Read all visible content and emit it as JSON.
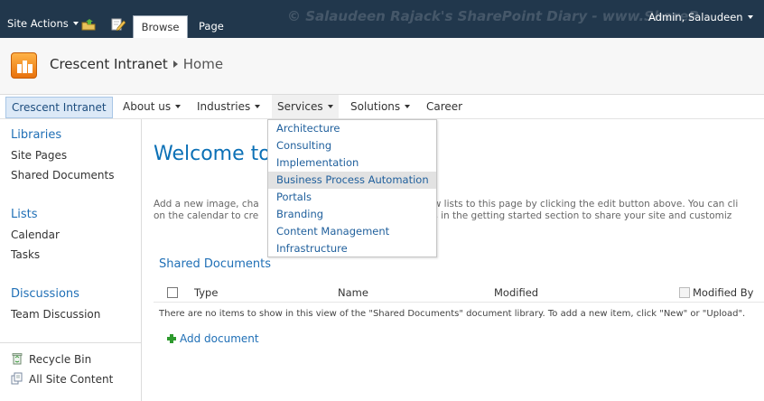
{
  "ribbon": {
    "site_actions_label": "Site Actions",
    "tabs": [
      {
        "label": "Browse",
        "selected": true
      },
      {
        "label": "Page",
        "selected": false
      }
    ],
    "watermark": "© Salaudeen Rajack's SharePoint Diary - www.ShareP",
    "user_name": "Admin, Salaudeen"
  },
  "site": {
    "title": "Crescent Intranet",
    "current_page": "Home"
  },
  "topnav": {
    "items": [
      {
        "label": "Crescent Intranet",
        "selected": true,
        "has_menu": false
      },
      {
        "label": "About us",
        "has_menu": true
      },
      {
        "label": "Industries",
        "has_menu": true
      },
      {
        "label": "Services",
        "has_menu": true,
        "open": true
      },
      {
        "label": "Solutions",
        "has_menu": true
      },
      {
        "label": "Career",
        "has_menu": false
      }
    ]
  },
  "dropdown": {
    "items": [
      {
        "label": "Architecture"
      },
      {
        "label": "Consulting"
      },
      {
        "label": "Implementation"
      },
      {
        "label": "Business Process Automation",
        "hover": true
      },
      {
        "label": "Portals"
      },
      {
        "label": "Branding"
      },
      {
        "label": "Content Management"
      },
      {
        "label": "Infrastructure"
      }
    ]
  },
  "quicklaunch": {
    "libraries_heading": "Libraries",
    "libraries": [
      "Site Pages",
      "Shared Documents"
    ],
    "lists_heading": "Lists",
    "lists": [
      "Calendar",
      "Tasks"
    ],
    "discussions_heading": "Discussions",
    "discussions": [
      "Team Discussion"
    ],
    "recycle_bin": "Recycle Bin",
    "all_site_content": "All Site Content"
  },
  "main": {
    "welcome_title": "Welcome to",
    "desc_line1_a": "Add a new image, cha",
    "desc_line1_b": "w lists to this page by clicking the edit button above. You can cli",
    "desc_line2_a": "on the calendar to cre",
    "desc_line2_b": "ks in the getting started section to share your site and customiz",
    "webpart_title": "Shared Documents",
    "columns": [
      "Type",
      "Name",
      "Modified",
      "Modified By"
    ],
    "empty_message": "There are no items to show in this view of the \"Shared Documents\" document library. To add a new item, click \"New\" or \"Upload\".",
    "add_document": "Add document"
  },
  "colors": {
    "ribbon_bg": "#21374c",
    "link_blue": "#1f6fb6",
    "heading_blue": "#0b70b6",
    "nav_selected_bg": "#dce9f7",
    "dropdown_hover_bg": "#e2e2e2"
  }
}
